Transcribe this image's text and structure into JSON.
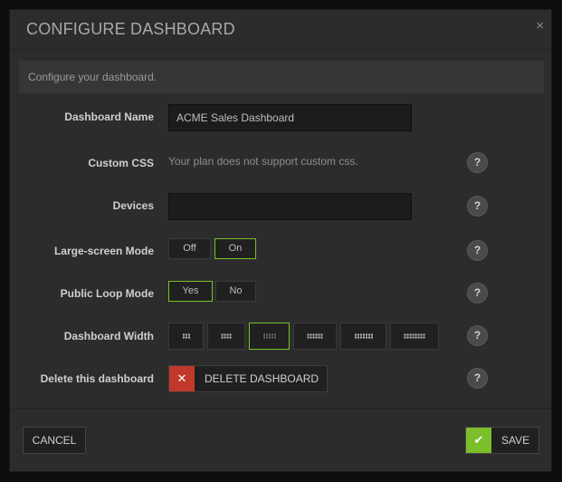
{
  "dialog": {
    "title": "CONFIGURE DASHBOARD",
    "close_glyph": "×",
    "intro": "Configure your dashboard."
  },
  "form": {
    "name": {
      "label": "Dashboard Name",
      "value": "ACME Sales Dashboard"
    },
    "css": {
      "label": "Custom CSS",
      "note": "Your plan does not support custom css."
    },
    "devices": {
      "label": "Devices",
      "value": ""
    },
    "large_screen": {
      "label": "Large-screen Mode",
      "options": [
        "Off",
        "On"
      ],
      "selected": "On"
    },
    "public_loop": {
      "label": "Public Loop Mode",
      "options": [
        "Yes",
        "No"
      ],
      "selected": "Yes"
    },
    "width": {
      "label": "Dashboard Width",
      "option_columns": [
        3,
        4,
        5,
        6,
        7,
        8
      ],
      "selected_columns": 5
    },
    "delete": {
      "label": "Delete this dashboard",
      "button": "DELETE DASHBOARD",
      "icon": "x-icon"
    },
    "help_glyph": "?"
  },
  "footer": {
    "cancel": "CANCEL",
    "save": "SAVE",
    "save_icon": "check-icon"
  },
  "colors": {
    "accent": "#7cbf2a",
    "danger": "#c0392b",
    "modal_bg": "#2c2c2c"
  }
}
